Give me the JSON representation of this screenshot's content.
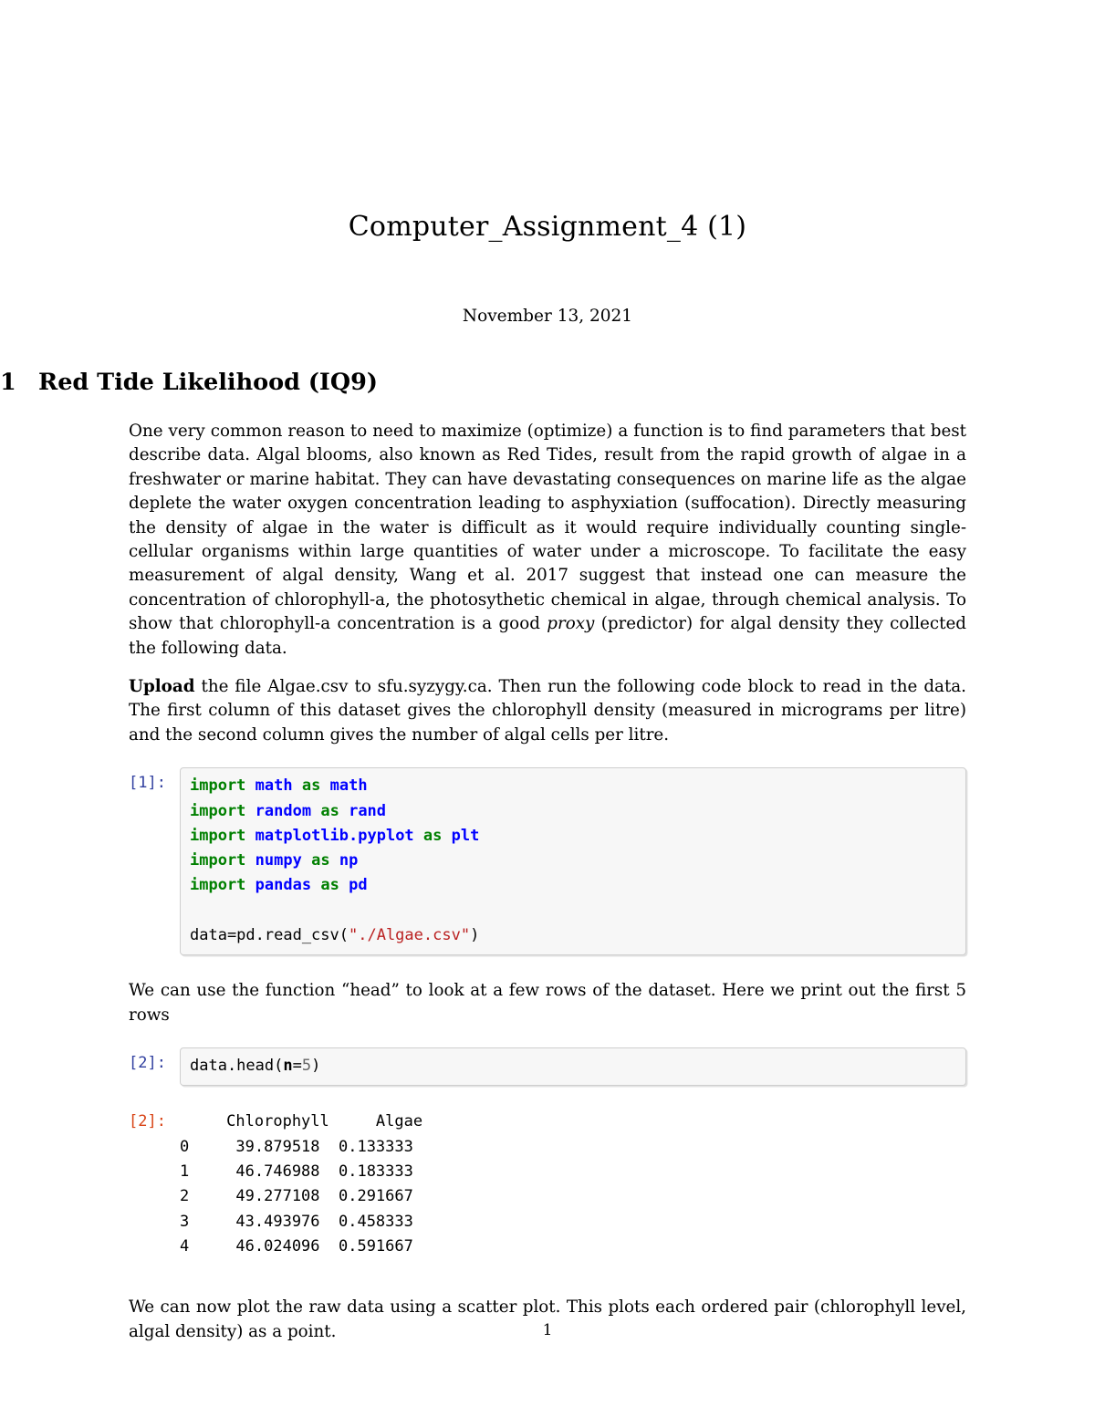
{
  "document": {
    "title": "Computer_Assignment_4 (1)",
    "date": "November 13, 2021",
    "page_number": "1"
  },
  "section": {
    "number": "1",
    "heading": "Red Tide Likelihood (IQ9)"
  },
  "paragraphs": {
    "intro_part1": "One very common reason to need to maximize (optimize) a function is to find parameters that best describe data. Algal blooms, also known as Red Tides, result from the rapid growth of algae in a freshwater or marine habitat.  They can have devastating consequences on marine life as the algae deplete the water oxygen concentration leading to asphyxiation (suffocation).  Directly measuring the density of algae in the water is difficult as it would require individually counting single-cellular organisms within large quantities of water under a microscope.  To facilitate the easy measurement of algal density, Wang et al. 2017 suggest that instead one can measure the concentration of chlorophyll-a, the photosythetic chemical in algae, through chemical analysis. To show that chlorophyll-a concentration is a good ",
    "intro_italic": "proxy",
    "intro_part2": " (predictor) for algal density they collected the following data.",
    "upload_bold": "Upload",
    "upload_rest": " the file Algae.csv to sfu.syzygy.ca.  Then run the following code block to read in the data. The first column of this dataset gives the chlorophyll density (measured in micrograms per litre) and the second column gives the number of algal cells per litre.",
    "head_explain": "We can use the function “head” to look at a few rows of the dataset.  Here we print out the first 5 rows",
    "scatter_explain": "We can now plot the raw data using a scatter plot.  This plots each ordered pair (chlorophyll level, algal density) as a point."
  },
  "cells": [
    {
      "prompt_in": "[1]:",
      "code_lines": [
        [
          {
            "t": "import",
            "c": "k"
          },
          {
            "t": " ",
            "c": ""
          },
          {
            "t": "math",
            "c": "nn"
          },
          {
            "t": " ",
            "c": ""
          },
          {
            "t": "as",
            "c": "k"
          },
          {
            "t": " ",
            "c": ""
          },
          {
            "t": "math",
            "c": "nn"
          }
        ],
        [
          {
            "t": "import",
            "c": "k"
          },
          {
            "t": " ",
            "c": ""
          },
          {
            "t": "random",
            "c": "nn"
          },
          {
            "t": " ",
            "c": ""
          },
          {
            "t": "as",
            "c": "k"
          },
          {
            "t": " ",
            "c": ""
          },
          {
            "t": "rand",
            "c": "nn"
          }
        ],
        [
          {
            "t": "import",
            "c": "k"
          },
          {
            "t": " ",
            "c": ""
          },
          {
            "t": "matplotlib.pyplot",
            "c": "nn"
          },
          {
            "t": " ",
            "c": ""
          },
          {
            "t": "as",
            "c": "k"
          },
          {
            "t": " ",
            "c": ""
          },
          {
            "t": "plt",
            "c": "nn"
          }
        ],
        [
          {
            "t": "import",
            "c": "k"
          },
          {
            "t": " ",
            "c": ""
          },
          {
            "t": "numpy",
            "c": "nn"
          },
          {
            "t": " ",
            "c": ""
          },
          {
            "t": "as",
            "c": "k"
          },
          {
            "t": " ",
            "c": ""
          },
          {
            "t": "np",
            "c": "nn"
          }
        ],
        [
          {
            "t": "import",
            "c": "k"
          },
          {
            "t": " ",
            "c": ""
          },
          {
            "t": "pandas",
            "c": "nn"
          },
          {
            "t": " ",
            "c": ""
          },
          {
            "t": "as",
            "c": "k"
          },
          {
            "t": " ",
            "c": ""
          },
          {
            "t": "pd",
            "c": "nn"
          }
        ],
        [],
        [
          {
            "t": "data=pd.read_csv(",
            "c": ""
          },
          {
            "t": "\"./Algae.csv\"",
            "c": "s"
          },
          {
            "t": ")",
            "c": ""
          }
        ]
      ]
    },
    {
      "prompt_in": "[2]:",
      "code_lines": [
        [
          {
            "t": "data.head(",
            "c": ""
          },
          {
            "t": "n",
            "c": "nb2"
          },
          {
            "t": "=",
            "c": ""
          },
          {
            "t": "5",
            "c": "mi"
          },
          {
            "t": ")",
            "c": ""
          }
        ]
      ]
    }
  ],
  "output": {
    "prompt_out": "[2]:",
    "table": {
      "index_header": "",
      "columns": [
        "Chlorophyll",
        "Algae"
      ],
      "index": [
        "0",
        "1",
        "2",
        "3",
        "4"
      ],
      "rows": [
        [
          "39.879518",
          "0.133333"
        ],
        [
          "46.746988",
          "0.183333"
        ],
        [
          "49.277108",
          "0.291667"
        ],
        [
          "43.493976",
          "0.458333"
        ],
        [
          "46.024096",
          "0.591667"
        ]
      ],
      "text": "     Chlorophyll     Algae\n0     39.879518  0.133333\n1     46.746988  0.183333\n2     49.277108  0.291667\n3     43.493976  0.458333\n4     46.024096  0.591667"
    }
  },
  "colors": {
    "keyword": "#008000",
    "module": "#0000ff",
    "string": "#ba2121",
    "number": "#666666",
    "prompt_in": "#303f9f",
    "prompt_out": "#d84315",
    "cell_background": "#f7f7f7",
    "cell_border": "#cfcfcf"
  }
}
